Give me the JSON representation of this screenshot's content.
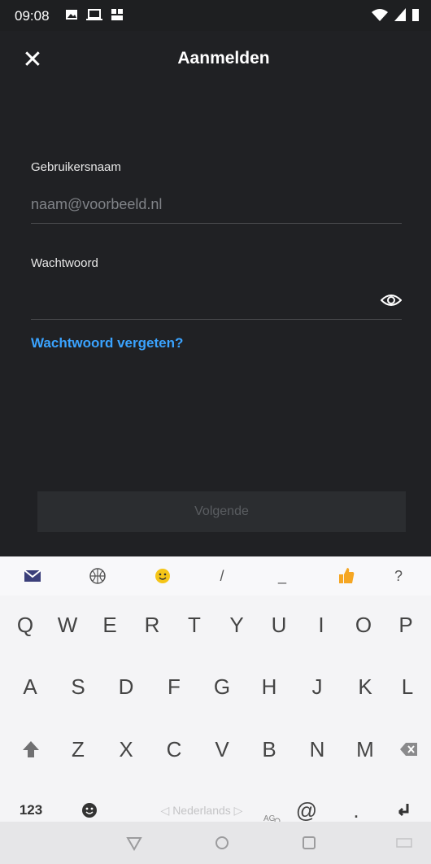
{
  "status": {
    "time": "09:08"
  },
  "header": {
    "title": "Aanmelden",
    "close_icon": "close-icon"
  },
  "form": {
    "username_label": "Gebruikersnaam",
    "username_placeholder": "naam@voorbeeld.nl",
    "password_label": "Wachtwoord",
    "forgot_link": "Wachtwoord vergeten?",
    "next_button": "Volgende"
  },
  "keyboard": {
    "suggestions": [
      "mail-icon",
      "globe-icon",
      "emoji-icon",
      "/",
      "_",
      "thumbs-up-icon",
      "?"
    ],
    "row1": [
      "Q",
      "W",
      "E",
      "R",
      "T",
      "Y",
      "U",
      "I",
      "O",
      "P"
    ],
    "row2": [
      "A",
      "S",
      "D",
      "F",
      "G",
      "H",
      "J",
      "K",
      "L"
    ],
    "row3": [
      "Z",
      "X",
      "C",
      "V",
      "B",
      "N",
      "M"
    ],
    "numbers_key": "123",
    "space_label": "◁ Nederlands ▷",
    "at_key": "@",
    "period_key": "."
  },
  "colors": {
    "link": "#3aa3ff",
    "background": "#202124"
  }
}
